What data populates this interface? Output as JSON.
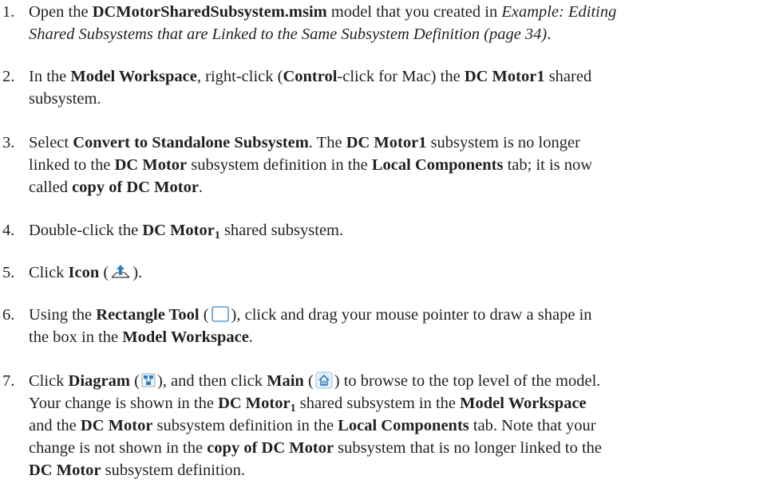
{
  "steps": [
    {
      "number": "1.",
      "line1_a": "Open the ",
      "line1_b": "DCMotorSharedSubsystem.msim",
      "line1_c": " model that you created in ",
      "line1_d": "Example: Editing",
      "line2_a": "Shared Subsystems that are Linked to the Same Subsystem Definition (page 34)",
      "line2_b": "."
    },
    {
      "number": "2.",
      "line1_a": "In the ",
      "line1_b": "Model Workspace",
      "line1_c": ", right-click (",
      "line1_d": "Control",
      "line1_e": "-click for Mac) the ",
      "line1_f": "DC Motor1",
      "line1_g": " shared",
      "line2_a": "subsystem."
    },
    {
      "number": "3.",
      "line1_a": "Select ",
      "line1_b": "Convert to Standalone Subsystem",
      "line1_c": ". The ",
      "line1_d": "DC Motor1",
      "line1_e": " subsystem is no longer",
      "line2_a": "linked to the ",
      "line2_b": "DC Motor",
      "line2_c": " subsystem definition in the ",
      "line2_d": "Local Components",
      "line2_e": " tab; it is now",
      "line3_a": "called ",
      "line3_b": "copy of DC Motor",
      "line3_c": "."
    },
    {
      "number": "4.",
      "line1_a": "Double-click the ",
      "line1_b": "DC Motor",
      "line1_sub": "1",
      "line1_c": " shared subsystem."
    },
    {
      "number": "5.",
      "line1_a": "Click ",
      "line1_b": "Icon",
      "line1_c": " (",
      "line1_d": ")."
    },
    {
      "number": "6.",
      "line1_a": "Using the ",
      "line1_b": "Rectangle Tool",
      "line1_c": " (",
      "line1_d": "), click and drag your mouse pointer to draw a shape in",
      "line2_a": "the box in the ",
      "line2_b": "Model Workspace",
      "line2_c": "."
    },
    {
      "number": "7.",
      "line1_a": "Click ",
      "line1_b": "Diagram",
      "line1_c": " (",
      "line1_d": "), and then click ",
      "line1_e": "Main",
      "line1_f": " (",
      "line1_g": ") to browse to the top level of the model.",
      "line2_a": "Your change is shown in the ",
      "line2_b": "DC Motor",
      "line2_sub": "1",
      "line2_c": " shared subsystem in the ",
      "line2_d": "Model Workspace",
      "line3_a": "and the ",
      "line3_b": "DC Motor",
      "line3_c": " subsystem definition in the ",
      "line3_d": "Local Components",
      "line3_e": " tab. Note that your",
      "line4_a": "change is not shown in the ",
      "line4_b": "copy of DC Motor",
      "line4_c": " subsystem that is no longer linked to the",
      "line5_a": "DC Motor",
      "line5_b": " subsystem definition."
    }
  ],
  "icons": {
    "icon_view": "icon-view-icon",
    "rectangle_tool": "rectangle-tool-icon",
    "diagram_view": "diagram-view-icon",
    "main_home": "home-icon",
    "accent_blue": "#2a7fc1"
  }
}
